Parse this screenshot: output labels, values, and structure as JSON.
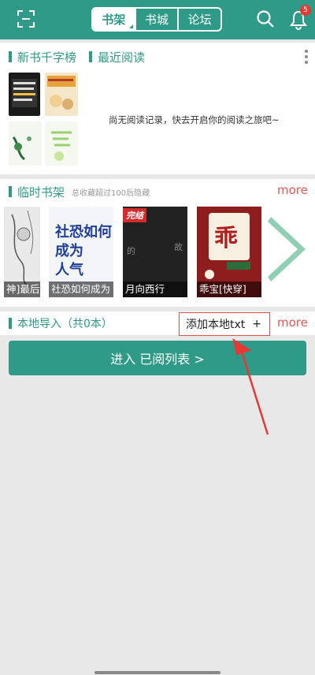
{
  "header": {
    "tabs": [
      {
        "label": "书架",
        "active": true
      },
      {
        "label": "书城",
        "active": false
      },
      {
        "label": "论坛",
        "active": false
      }
    ],
    "notification_count": "5",
    "accent": "#2e9a87"
  },
  "section_new": {
    "title_ranking": "新书千字榜",
    "title_recent": "最近阅读",
    "empty_hint": "尚无阅读记录，快去开启你的阅读之旅吧~"
  },
  "section_temp": {
    "title": "临时书架",
    "note": "总收藏超过100后隐藏",
    "more": "more",
    "books": [
      {
        "title": "神]最后"
      },
      {
        "title": "社恐如何成为"
      },
      {
        "title": "月向西行",
        "tag": "完结"
      },
      {
        "title": "乖宝[快穿]"
      }
    ]
  },
  "section_local": {
    "title": "本地导入（共0本）",
    "add_label": "添加本地txt",
    "add_symbol": "+",
    "more": "more"
  },
  "enter_button": {
    "label": "进入 已阅列表 >"
  }
}
